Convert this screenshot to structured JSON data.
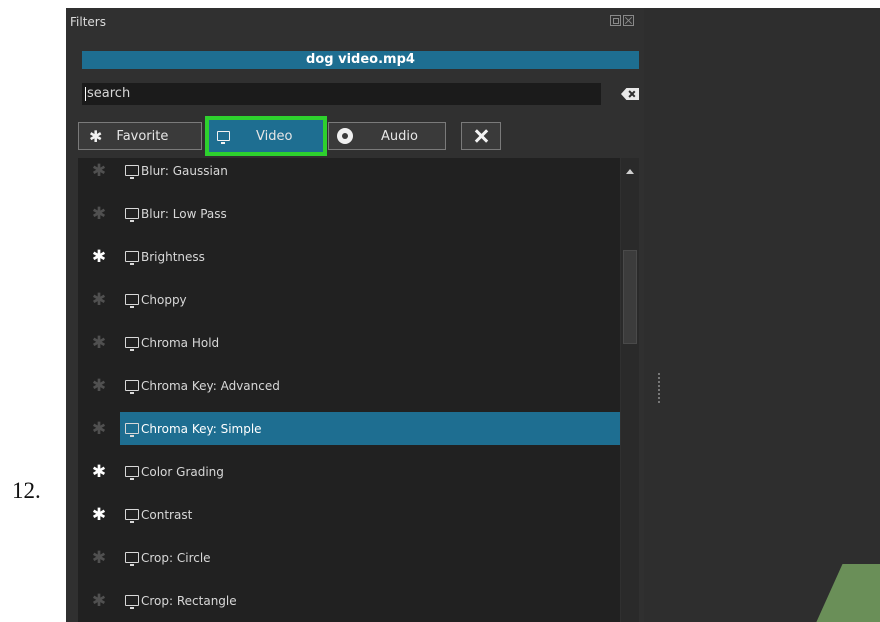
{
  "step_label": "12.",
  "panel": {
    "title": "Filters",
    "file_name": "dog video.mp4",
    "search": {
      "value": "search"
    }
  },
  "tabs": {
    "favorite": "Favorite",
    "video": "Video",
    "audio": "Audio"
  },
  "filters": [
    {
      "label": "Blur: Gaussian",
      "favorite": false,
      "selected": false
    },
    {
      "label": "Blur: Low Pass",
      "favorite": false,
      "selected": false
    },
    {
      "label": "Brightness",
      "favorite": true,
      "selected": false
    },
    {
      "label": "Choppy",
      "favorite": false,
      "selected": false
    },
    {
      "label": "Chroma Hold",
      "favorite": false,
      "selected": false
    },
    {
      "label": "Chroma Key: Advanced",
      "favorite": false,
      "selected": false
    },
    {
      "label": "Chroma Key: Simple",
      "favorite": false,
      "selected": true
    },
    {
      "label": "Color Grading",
      "favorite": true,
      "selected": false
    },
    {
      "label": "Contrast",
      "favorite": true,
      "selected": false
    },
    {
      "label": "Crop: Circle",
      "favorite": false,
      "selected": false
    },
    {
      "label": "Crop: Rectangle",
      "favorite": false,
      "selected": false
    }
  ],
  "icons": {
    "star": "✱",
    "monitor": "monitor-icon",
    "disc": "disc-icon"
  },
  "colors": {
    "accent": "#1e6e91",
    "highlight": "#2ed12e",
    "panel_bg": "#303030",
    "list_bg": "#212121"
  }
}
